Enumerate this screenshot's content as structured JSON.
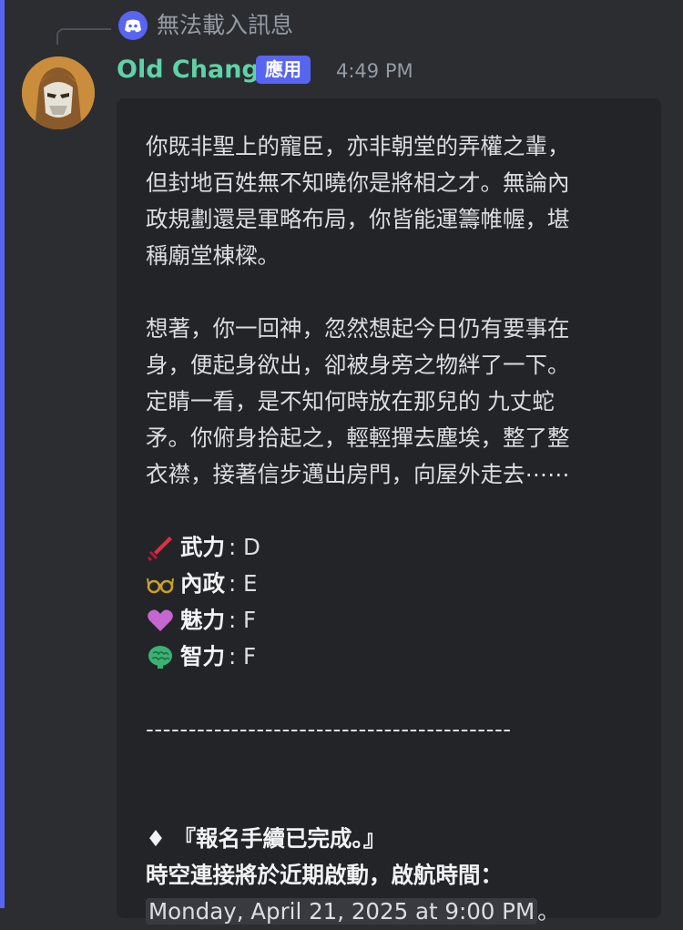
{
  "reply": {
    "text": "無法載入訊息",
    "icon": "discord-icon"
  },
  "author": {
    "name": "Old Chang",
    "badge": "應用",
    "timestamp": "4:49 PM",
    "avatar": "avatar-knight-image"
  },
  "message": {
    "paragraph1": "你既非聖上的寵臣，亦非朝堂的弄權之輩，\n但封地百姓無不知曉你是將相之才。無論內\n政規劃還是軍略布局，你皆能運籌帷幄，堪\n稱廟堂棟樑。",
    "paragraph2": "想著，你一回神，忽然想起今日仍有要事在\n身，便起身欲出，卻被身旁之物絆了一下。\n定睛一看，是不知何時放在那兒的 九丈蛇\n矛。你俯身拾起之，輕輕撣去塵埃，整了整\n衣襟，接著信步邁出房門，向屋外走去⋯⋯",
    "stats": [
      {
        "icon": "sword-icon",
        "label": "武力",
        "value": "D"
      },
      {
        "icon": "glasses-icon",
        "label": "內政",
        "value": "E"
      },
      {
        "icon": "heart-icon",
        "label": "魅力",
        "value": "F"
      },
      {
        "icon": "brain-icon",
        "label": "智力",
        "value": "F"
      }
    ],
    "divider": "-------------------------------------------",
    "notice_title": "♦ 『報名手續已完成。』",
    "notice_line": "時空連接將於近期啟動，啟航時間：",
    "launch_time": "Monday, April 21, 2025 at 9:00 PM",
    "launch_suffix": "。"
  },
  "colors": {
    "accent": "#5865f2",
    "username": "#5fd2a8",
    "background": "#2b2d31",
    "embed": "#232428"
  }
}
